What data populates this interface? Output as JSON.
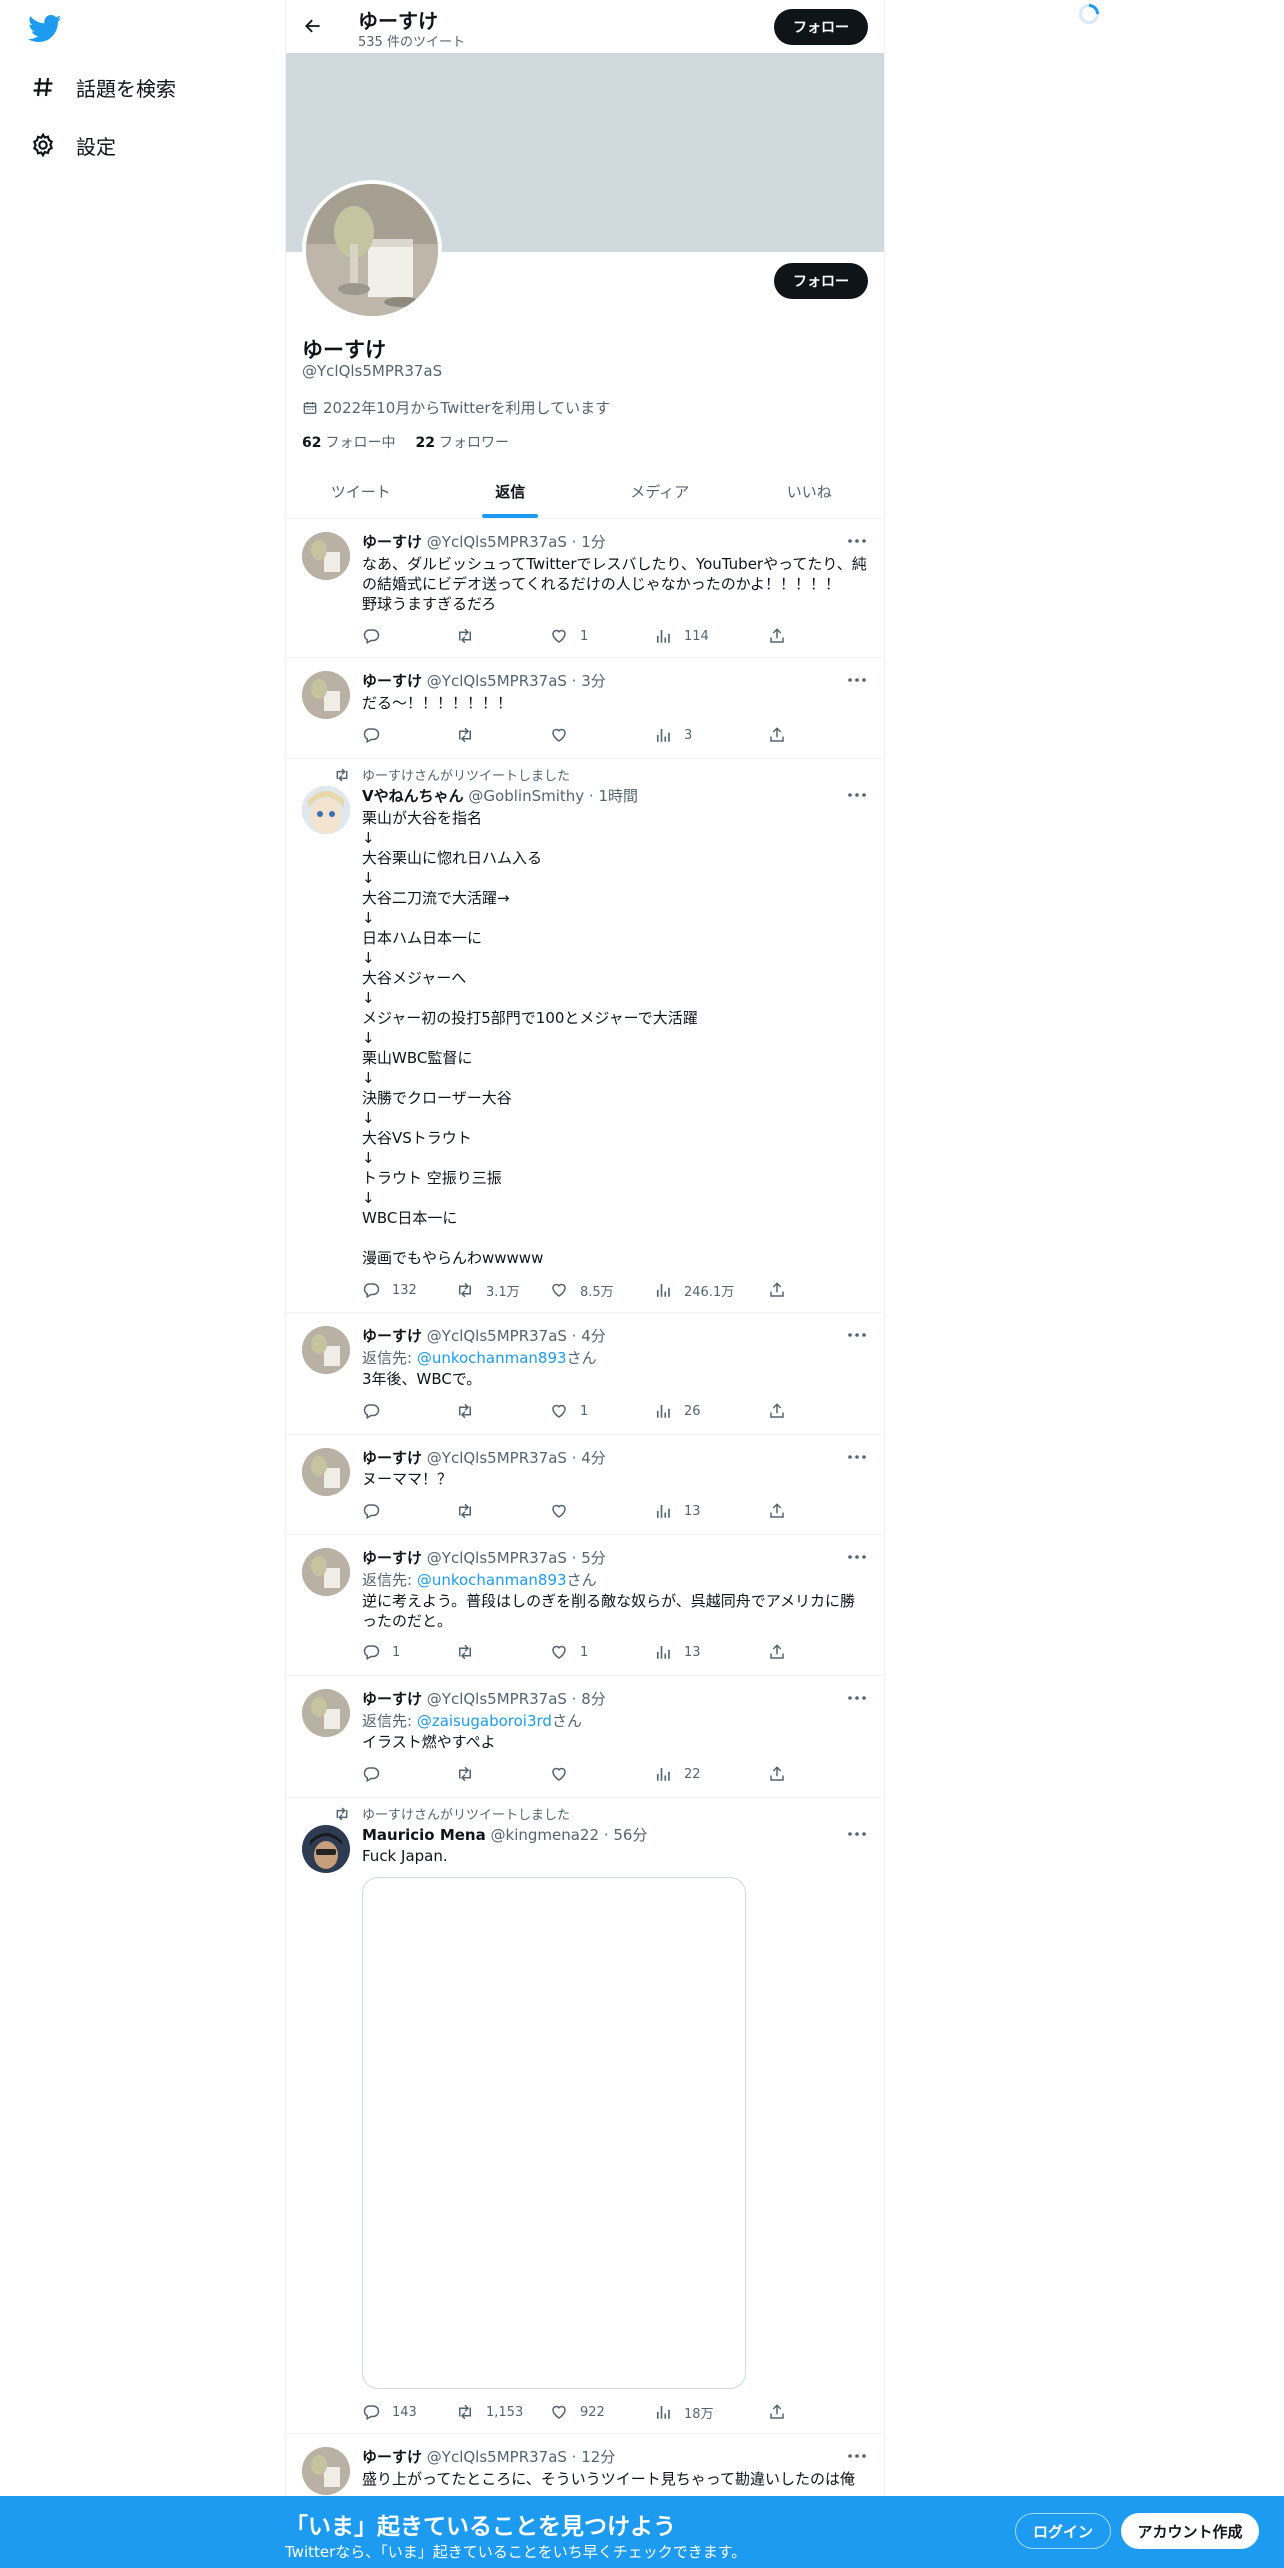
{
  "colors": {
    "accent": "#1d9bf0",
    "text": "#0f1419",
    "muted": "#536471",
    "banner": "#cfd9de"
  },
  "sidebar": {
    "logo": "twitter-bird-icon",
    "items": [
      {
        "label": "話題を検索",
        "icon": "hashtag-icon"
      },
      {
        "label": "設定",
        "icon": "gear-icon"
      }
    ]
  },
  "topbar": {
    "name": "ゆーすけ",
    "count": "535 件のツイート",
    "follow_label": "フォロー"
  },
  "profile": {
    "name": "ゆーすけ",
    "handle": "@YclQls5MPR37aS",
    "joined": "2022年10月からTwitterを利用しています",
    "following_count": "62",
    "following_label": "フォロー中",
    "followers_count": "22",
    "followers_label": "フォロワー",
    "follow_label": "フォロー"
  },
  "tabs": [
    {
      "label": "ツイート"
    },
    {
      "label": "返信",
      "active": true
    },
    {
      "label": "メディア"
    },
    {
      "label": "いいね"
    }
  ],
  "tweets": [
    {
      "name": "ゆーすけ",
      "meta": "@YclQls5MPR37aS · 1分",
      "text": "なあ、ダルビッシュってTwitterでレスバしたり、YouTuberやってたり、純の結婚式にビデオ送ってくれるだけの人じゃなかったのかよ！！！！！\n野球うますぎるだろ",
      "reply": "",
      "like": "1",
      "views": "114"
    },
    {
      "name": "ゆーすけ",
      "meta": "@YclQls5MPR37aS · 3分",
      "text": "だる〜！！！！！！！",
      "reply": "",
      "like": "",
      "views": "3"
    },
    {
      "retweet_label": "ゆーすけさんがリツイートしました",
      "name": "Vやねんちゃん",
      "meta": "@GoblinSmithy · 1時間",
      "text": "栗山が大谷を指名\n↓\n大谷栗山に惚れ日ハム入る\n↓\n大谷二刀流で大活躍→\n↓\n日本ハム日本一に\n↓\n大谷メジャーへ\n↓\nメジャー初の投打5部門で100とメジャーで大活躍\n↓\n栗山WBC監督に\n↓\n決勝でクローザー大谷\n↓\n大谷VSトラウト\n↓\nトラウト 空振り三振\n↓\nWBC日本一に\n\n漫画でもやらんわwwwww",
      "reply": "132",
      "retweet": "3.1万",
      "like": "8.5万",
      "views": "246.1万"
    },
    {
      "name": "ゆーすけ",
      "meta": "@YclQls5MPR37aS · 4分",
      "reply_to_prefix": "返信先: ",
      "reply_to_handle": "@unkochanman893",
      "reply_to_suffix": "さん",
      "text": "3年後、WBCで。",
      "reply": "",
      "like": "1",
      "views": "26"
    },
    {
      "name": "ゆーすけ",
      "meta": "@YclQls5MPR37aS · 4分",
      "text": "ヌーママ！？",
      "reply": "",
      "like": "",
      "views": "13"
    },
    {
      "name": "ゆーすけ",
      "meta": "@YclQls5MPR37aS · 5分",
      "reply_to_prefix": "返信先: ",
      "reply_to_handle": "@unkochanman893",
      "reply_to_suffix": "さん",
      "text": "逆に考えよう。普段はしのぎを削る敵な奴らが、呉越同舟でアメリカに勝ったのだと。",
      "reply": "1",
      "like": "1",
      "views": "13"
    },
    {
      "name": "ゆーすけ",
      "meta": "@YclQls5MPR37aS · 8分",
      "reply_to_prefix": "返信先: ",
      "reply_to_handle": "@zaisugaboroi3rd",
      "reply_to_suffix": "さん",
      "text": "イラスト燃やすぺよ",
      "reply": "",
      "like": "",
      "views": "22"
    },
    {
      "retweet_label": "ゆーすけさんがリツイートしました",
      "name": "Mauricio Mena",
      "meta": "@kingmena22 · 56分",
      "text": "Fuck Japan.",
      "reply": "143",
      "retweet": "1,153",
      "like": "922",
      "views": "18万"
    },
    {
      "name": "ゆーすけ",
      "meta": "@YclQls5MPR37aS · 12分",
      "text": "盛り上がってたところに、そういうツイート見ちゃって勘違いしたのは俺"
    }
  ],
  "bottom_banner": {
    "title": "「いま」起きていることを見つけよう",
    "subtitle": "Twitterなら、「いま」起きていることをいち早くチェックできます。",
    "login_label": "ログイン",
    "signup_label": "アカウント作成"
  }
}
